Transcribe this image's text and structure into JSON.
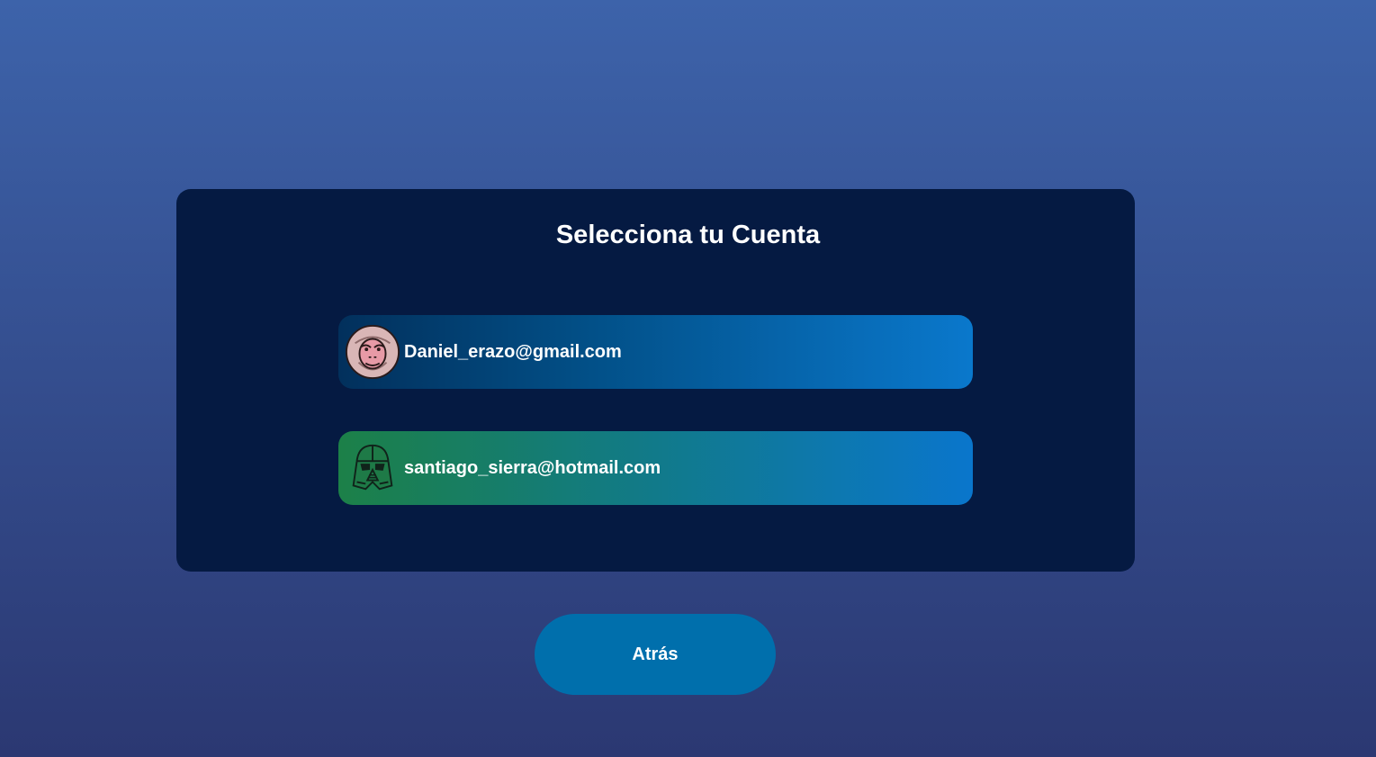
{
  "title": "Selecciona tu Cuenta",
  "accounts": [
    {
      "email": "Daniel_erazo@gmail.com",
      "avatar_icon": "monkey-face-icon"
    },
    {
      "email": "santiago_sierra@hotmail.com",
      "avatar_icon": "darth-vader-helmet-icon"
    }
  ],
  "back_label": "Atrás",
  "colors": {
    "background_top": "#3d63aa",
    "background_bottom": "#2b3872",
    "panel": "#051a42",
    "button": "#006fac",
    "text": "#ffffff"
  }
}
